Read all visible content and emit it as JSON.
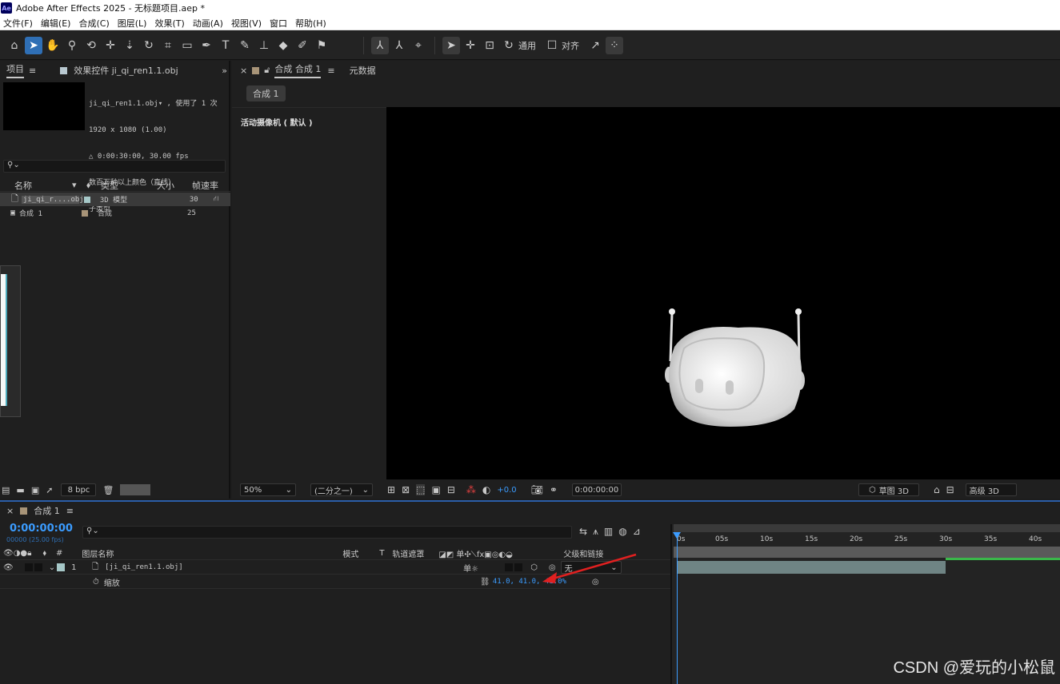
{
  "window": {
    "app_title": "Adobe After Effects 2025 - 无标题项目.aep *",
    "logo_text": "Ae"
  },
  "menu": [
    "文件(F)",
    "编辑(E)",
    "合成(C)",
    "图层(L)",
    "效果(T)",
    "动画(A)",
    "视图(V)",
    "窗口",
    "帮助(H)"
  ],
  "toolbar": {
    "universal_label": "通用",
    "snap_label": "对齐"
  },
  "project_panel": {
    "tab_project": "项目",
    "tab_effects": "效果控件 ji_qi_ren1.1.obj",
    "info_lines": [
      "ji_qi_ren1.1.obj▾ , 使用了 1 次",
      "1920 x 1080 (1.00)",
      "△ 0:00:30:00, 30.00 fps",
      "数百万种以上颜色（直线）",
      "子类型"
    ],
    "columns": {
      "name": "名称",
      "type": "类型",
      "size": "大小",
      "fps": "帧速率"
    },
    "items": [
      {
        "name": "ji_qi_r....obj",
        "type": "3D 模型",
        "fps": "30",
        "swatch": "#a6c8c8"
      },
      {
        "name": "合成 1",
        "type": "合成",
        "fps": "25",
        "swatch": "#a89478"
      }
    ],
    "bpc": "8 bpc"
  },
  "comp_panel": {
    "tab_label": "合成 合成 1",
    "tab_meta": "元数据",
    "comp_chip": "合成 1",
    "camera_label": "活动摄像机 ( 默认 )",
    "zoom": "50%",
    "resolution": "(二分之一)",
    "exposure": "+0.0",
    "timecode": "0:00:00:00",
    "draft3d": "草图 3D",
    "quality3d": "高级 3D"
  },
  "timeline": {
    "tab_label": "合成 1",
    "timecode": "0:00:00:00",
    "frame_info": "00000 (25.00 fps)",
    "col_layer_name": "图层名称",
    "col_mode": "模式",
    "col_t": "T",
    "col_track": "轨道遮罩",
    "col_parent": "父级和链接",
    "layer": {
      "index": "1",
      "name": "[ji_qi_ren1.1.obj]",
      "parent": "无"
    },
    "property": {
      "name": "缩放",
      "value": "41.0, 41.0, 41.0%"
    },
    "ruler": [
      "0s",
      "05s",
      "10s",
      "15s",
      "20s",
      "25s",
      "30s",
      "35s",
      "40s"
    ]
  },
  "watermark": "CSDN @爱玩的小松鼠"
}
